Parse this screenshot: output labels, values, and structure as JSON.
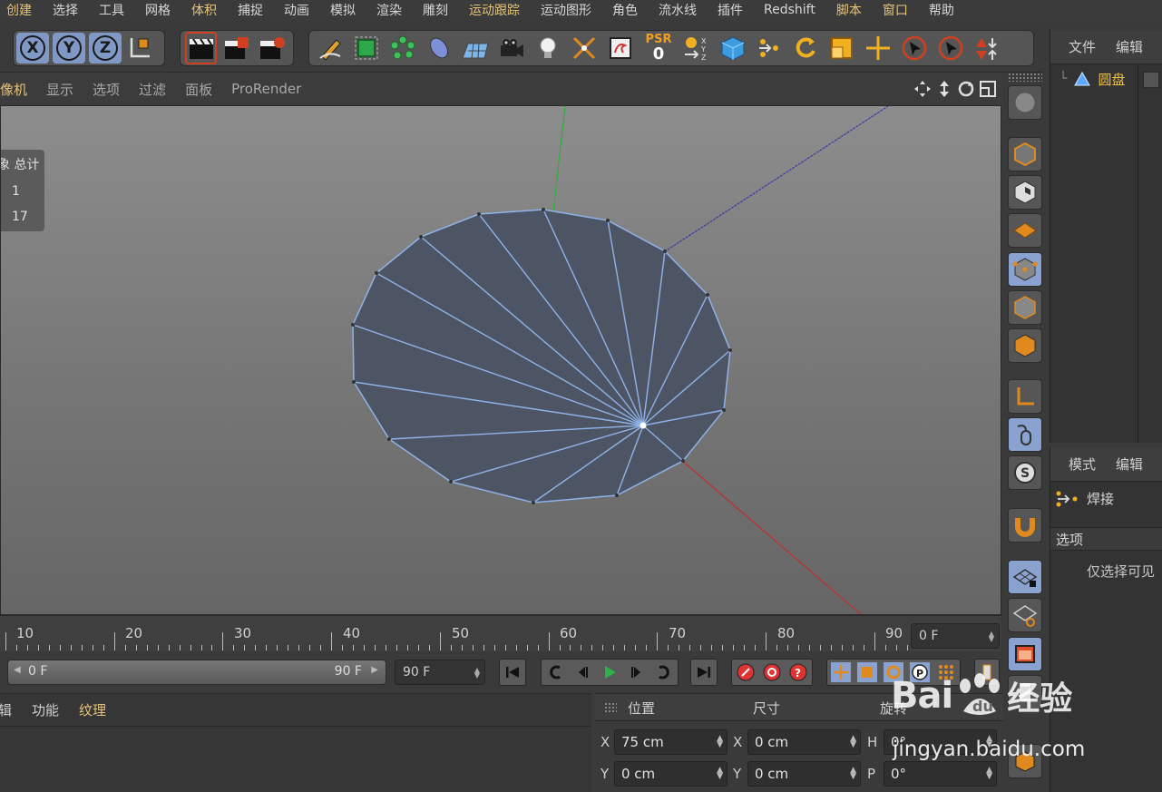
{
  "menu": [
    "创建",
    "选择",
    "工具",
    "网格",
    "体积",
    "捕捉",
    "动画",
    "模拟",
    "渲染",
    "雕刻",
    "运动跟踪",
    "运动图形",
    "角色",
    "流水线",
    "插件",
    "Redshift",
    "脚本",
    "窗口",
    "帮助"
  ],
  "toolbar": {
    "axis_x": "X",
    "axis_y": "Y",
    "axis_z": "Z",
    "psr_label": "PSR",
    "psr_value": "0"
  },
  "viewport_menu": [
    "像机",
    "显示",
    "选项",
    "过滤",
    "面板",
    "ProRender"
  ],
  "hud": {
    "header": "象 总计",
    "row1": "1",
    "row2": "17"
  },
  "object_manager": {
    "tabs": [
      "文件",
      "编辑"
    ],
    "object_name": "圆盘"
  },
  "attribute_manager": {
    "tabs": [
      "模式",
      "编辑"
    ],
    "tool_name": "焊接",
    "section": "选项",
    "option": "仅选择可见"
  },
  "timeline": {
    "ticks": [
      "10",
      "20",
      "30",
      "40",
      "50",
      "60",
      "70",
      "80",
      "90"
    ],
    "current_frame": "0 F"
  },
  "transport": {
    "range_start": "0 F",
    "range_end": "90 F",
    "end_field": "90 F"
  },
  "material_manager": {
    "tabs": [
      "辑",
      "功能",
      "纹理"
    ]
  },
  "coordinates": {
    "headers": [
      "位置",
      "尺寸",
      "旋转"
    ],
    "pos_x_label": "X",
    "pos_x": "75 cm",
    "pos_y_label": "Y",
    "pos_y": "0 cm",
    "size_x_label": "X",
    "size_x": "0 cm",
    "size_y_label": "Y",
    "size_y": "0 cm",
    "rot_h_label": "H",
    "rot_h": "0°",
    "rot_p_label": "P",
    "rot_p": "0°"
  },
  "watermark": {
    "brand": "Bai",
    "brand2": "经验",
    "url": "jingyan.baidu.com"
  },
  "colors": {
    "accent": "#e5c47a",
    "selected_blue": "#8aa2cf",
    "mesh_fill": "#4d5564",
    "mesh_edge": "#8fb2e8",
    "axis_y": "#2fae3a",
    "axis_z": "#3a3aa8",
    "axis_x": "#c0302a"
  }
}
